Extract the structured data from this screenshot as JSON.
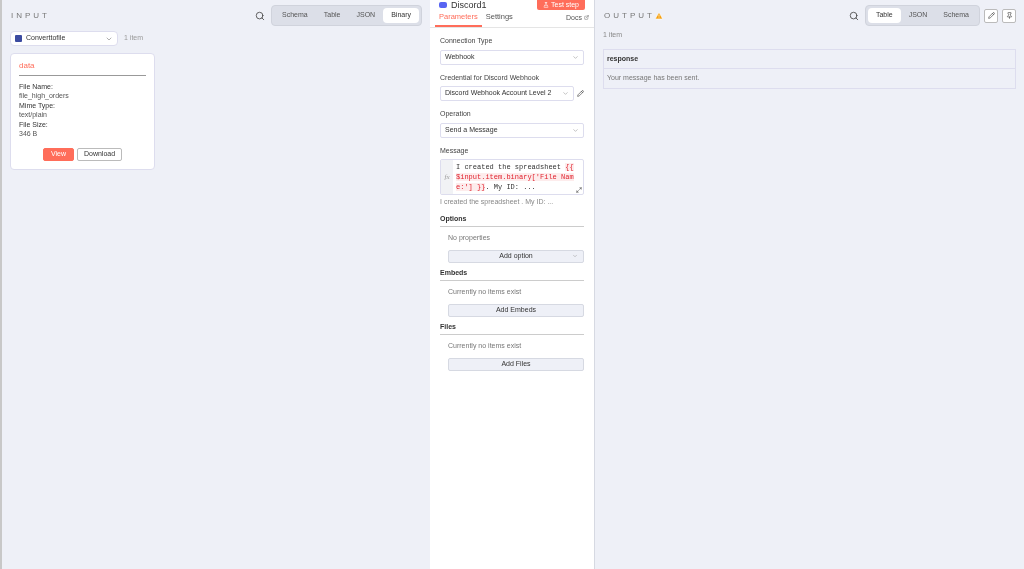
{
  "input": {
    "title": "INPUT",
    "view_tabs": [
      {
        "label": "Schema",
        "selected": false
      },
      {
        "label": "Table",
        "selected": false
      },
      {
        "label": "JSON",
        "selected": false
      },
      {
        "label": "Binary",
        "selected": true
      }
    ],
    "node_select": {
      "value": "Converttofile"
    },
    "count": "1 item",
    "binary_card": {
      "title": "data",
      "fields": [
        {
          "label": "File Name:",
          "value": "file_high_orders"
        },
        {
          "label": "Mime Type:",
          "value": "text/plain"
        },
        {
          "label": "File Size:",
          "value": "346 B"
        }
      ],
      "buttons": [
        {
          "label": "View",
          "kind": "primary"
        },
        {
          "label": "Download",
          "kind": "secondary"
        }
      ]
    }
  },
  "node": {
    "title": "Discord1",
    "test_button": "Test step",
    "tabs": [
      {
        "label": "Parameters",
        "selected": true
      },
      {
        "label": "Settings",
        "selected": false
      }
    ],
    "docs_link": "Docs",
    "params": [
      {
        "kind": "select",
        "label": "Connection Type",
        "value": "Webhook"
      },
      {
        "kind": "credential",
        "label": "Credential for Discord Webhook",
        "value": "Discord Webhook Account Level 2"
      },
      {
        "kind": "select",
        "label": "Operation",
        "value": "Send a Message"
      },
      {
        "kind": "expression",
        "label": "Message",
        "mode": "fx",
        "segments": [
          {
            "kind": "text",
            "text": "I created the spreadsheet "
          },
          {
            "kind": "expression",
            "text": "{{ $input.item.binary['File Name:'] }}"
          },
          {
            "kind": "text",
            "text": ". My ID: ..."
          }
        ],
        "preview": "I created the spreadsheet . My ID: ..."
      }
    ],
    "sections": [
      {
        "title": "Options",
        "empty_text": "No properties",
        "button": "Add option",
        "dropdown": true
      },
      {
        "title": "Embeds",
        "empty_text": "Currently no items exist",
        "button": "Add Embeds",
        "dropdown": false
      },
      {
        "title": "Files",
        "empty_text": "Currently no items exist",
        "button": "Add Files",
        "dropdown": false
      }
    ]
  },
  "output": {
    "title": "OUTPUT",
    "warning": true,
    "view_tabs": [
      {
        "label": "Table",
        "selected": true
      },
      {
        "label": "JSON",
        "selected": false
      },
      {
        "label": "Schema",
        "selected": false
      }
    ],
    "count": "1 item",
    "table": {
      "columns": [
        "response"
      ],
      "rows": [
        [
          "Your message has been sent."
        ]
      ]
    }
  }
}
